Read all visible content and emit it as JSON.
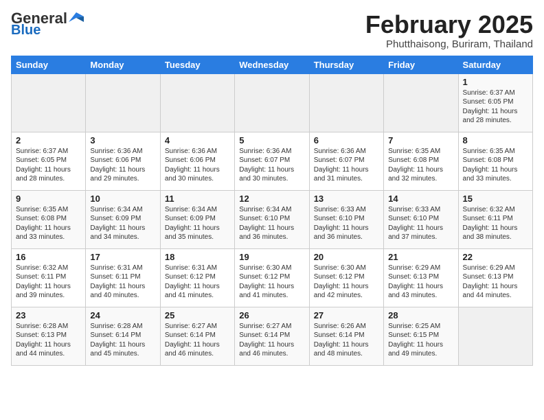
{
  "header": {
    "logo_general": "General",
    "logo_blue": "Blue",
    "month_title": "February 2025",
    "location": "Phutthaisong, Buriram, Thailand"
  },
  "days_of_week": [
    "Sunday",
    "Monday",
    "Tuesday",
    "Wednesday",
    "Thursday",
    "Friday",
    "Saturday"
  ],
  "weeks": [
    [
      {
        "day": "",
        "info": ""
      },
      {
        "day": "",
        "info": ""
      },
      {
        "day": "",
        "info": ""
      },
      {
        "day": "",
        "info": ""
      },
      {
        "day": "",
        "info": ""
      },
      {
        "day": "",
        "info": ""
      },
      {
        "day": "1",
        "info": "Sunrise: 6:37 AM\nSunset: 6:05 PM\nDaylight: 11 hours\nand 28 minutes."
      }
    ],
    [
      {
        "day": "2",
        "info": "Sunrise: 6:37 AM\nSunset: 6:05 PM\nDaylight: 11 hours\nand 28 minutes."
      },
      {
        "day": "3",
        "info": "Sunrise: 6:36 AM\nSunset: 6:06 PM\nDaylight: 11 hours\nand 29 minutes."
      },
      {
        "day": "4",
        "info": "Sunrise: 6:36 AM\nSunset: 6:06 PM\nDaylight: 11 hours\nand 30 minutes."
      },
      {
        "day": "5",
        "info": "Sunrise: 6:36 AM\nSunset: 6:07 PM\nDaylight: 11 hours\nand 30 minutes."
      },
      {
        "day": "6",
        "info": "Sunrise: 6:36 AM\nSunset: 6:07 PM\nDaylight: 11 hours\nand 31 minutes."
      },
      {
        "day": "7",
        "info": "Sunrise: 6:35 AM\nSunset: 6:08 PM\nDaylight: 11 hours\nand 32 minutes."
      },
      {
        "day": "8",
        "info": "Sunrise: 6:35 AM\nSunset: 6:08 PM\nDaylight: 11 hours\nand 33 minutes."
      }
    ],
    [
      {
        "day": "9",
        "info": "Sunrise: 6:35 AM\nSunset: 6:08 PM\nDaylight: 11 hours\nand 33 minutes."
      },
      {
        "day": "10",
        "info": "Sunrise: 6:34 AM\nSunset: 6:09 PM\nDaylight: 11 hours\nand 34 minutes."
      },
      {
        "day": "11",
        "info": "Sunrise: 6:34 AM\nSunset: 6:09 PM\nDaylight: 11 hours\nand 35 minutes."
      },
      {
        "day": "12",
        "info": "Sunrise: 6:34 AM\nSunset: 6:10 PM\nDaylight: 11 hours\nand 36 minutes."
      },
      {
        "day": "13",
        "info": "Sunrise: 6:33 AM\nSunset: 6:10 PM\nDaylight: 11 hours\nand 36 minutes."
      },
      {
        "day": "14",
        "info": "Sunrise: 6:33 AM\nSunset: 6:10 PM\nDaylight: 11 hours\nand 37 minutes."
      },
      {
        "day": "15",
        "info": "Sunrise: 6:32 AM\nSunset: 6:11 PM\nDaylight: 11 hours\nand 38 minutes."
      }
    ],
    [
      {
        "day": "16",
        "info": "Sunrise: 6:32 AM\nSunset: 6:11 PM\nDaylight: 11 hours\nand 39 minutes."
      },
      {
        "day": "17",
        "info": "Sunrise: 6:31 AM\nSunset: 6:11 PM\nDaylight: 11 hours\nand 40 minutes."
      },
      {
        "day": "18",
        "info": "Sunrise: 6:31 AM\nSunset: 6:12 PM\nDaylight: 11 hours\nand 41 minutes."
      },
      {
        "day": "19",
        "info": "Sunrise: 6:30 AM\nSunset: 6:12 PM\nDaylight: 11 hours\nand 41 minutes."
      },
      {
        "day": "20",
        "info": "Sunrise: 6:30 AM\nSunset: 6:12 PM\nDaylight: 11 hours\nand 42 minutes."
      },
      {
        "day": "21",
        "info": "Sunrise: 6:29 AM\nSunset: 6:13 PM\nDaylight: 11 hours\nand 43 minutes."
      },
      {
        "day": "22",
        "info": "Sunrise: 6:29 AM\nSunset: 6:13 PM\nDaylight: 11 hours\nand 44 minutes."
      }
    ],
    [
      {
        "day": "23",
        "info": "Sunrise: 6:28 AM\nSunset: 6:13 PM\nDaylight: 11 hours\nand 44 minutes."
      },
      {
        "day": "24",
        "info": "Sunrise: 6:28 AM\nSunset: 6:14 PM\nDaylight: 11 hours\nand 45 minutes."
      },
      {
        "day": "25",
        "info": "Sunrise: 6:27 AM\nSunset: 6:14 PM\nDaylight: 11 hours\nand 46 minutes."
      },
      {
        "day": "26",
        "info": "Sunrise: 6:27 AM\nSunset: 6:14 PM\nDaylight: 11 hours\nand 46 minutes."
      },
      {
        "day": "27",
        "info": "Sunrise: 6:26 AM\nSunset: 6:14 PM\nDaylight: 11 hours\nand 48 minutes."
      },
      {
        "day": "28",
        "info": "Sunrise: 6:25 AM\nSunset: 6:15 PM\nDaylight: 11 hours\nand 49 minutes."
      },
      {
        "day": "",
        "info": ""
      }
    ]
  ]
}
